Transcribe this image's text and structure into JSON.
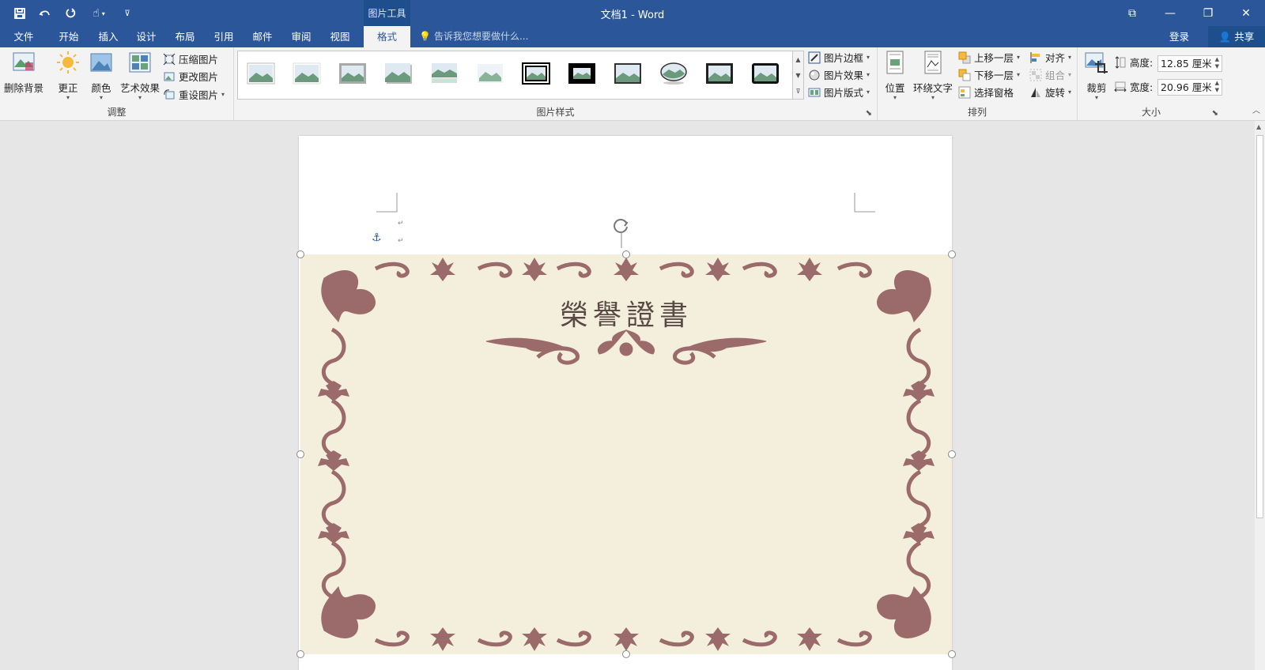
{
  "window": {
    "title": "文档1 - Word",
    "context_tab": "图片工具"
  },
  "tabs": {
    "file": "文件",
    "home": "开始",
    "insert": "插入",
    "design": "设计",
    "layout": "布局",
    "references": "引用",
    "mailings": "邮件",
    "review": "审阅",
    "view": "视图",
    "format": "格式"
  },
  "tell_me": "告诉我您想要做什么...",
  "account": {
    "login": "登录",
    "share": "共享"
  },
  "ribbon": {
    "adjust": {
      "label": "调整",
      "remove_bg": "删除背景",
      "corrections": "更正",
      "color": "颜色",
      "artistic": "艺术效果",
      "compress": "压缩图片",
      "change": "更改图片",
      "reset": "重设图片"
    },
    "styles": {
      "label": "图片样式",
      "border": "图片边框",
      "effects": "图片效果",
      "layout": "图片版式"
    },
    "arrange": {
      "label": "排列",
      "position": "位置",
      "wrap": "环绕文字",
      "bring_forward": "上移一层",
      "send_backward": "下移一层",
      "selection_pane": "选择窗格",
      "align": "对齐",
      "group": "组合",
      "rotate": "旋转"
    },
    "size": {
      "label": "大小",
      "crop": "裁剪",
      "height_label": "高度:",
      "height_value": "12.85 厘米",
      "width_label": "宽度:",
      "width_value": "20.96 厘米"
    }
  },
  "document": {
    "certificate_title": "榮譽證書",
    "colors": {
      "accent": "#2b579a",
      "frame": "#9b6b6b",
      "paper": "#f4eedc"
    }
  }
}
